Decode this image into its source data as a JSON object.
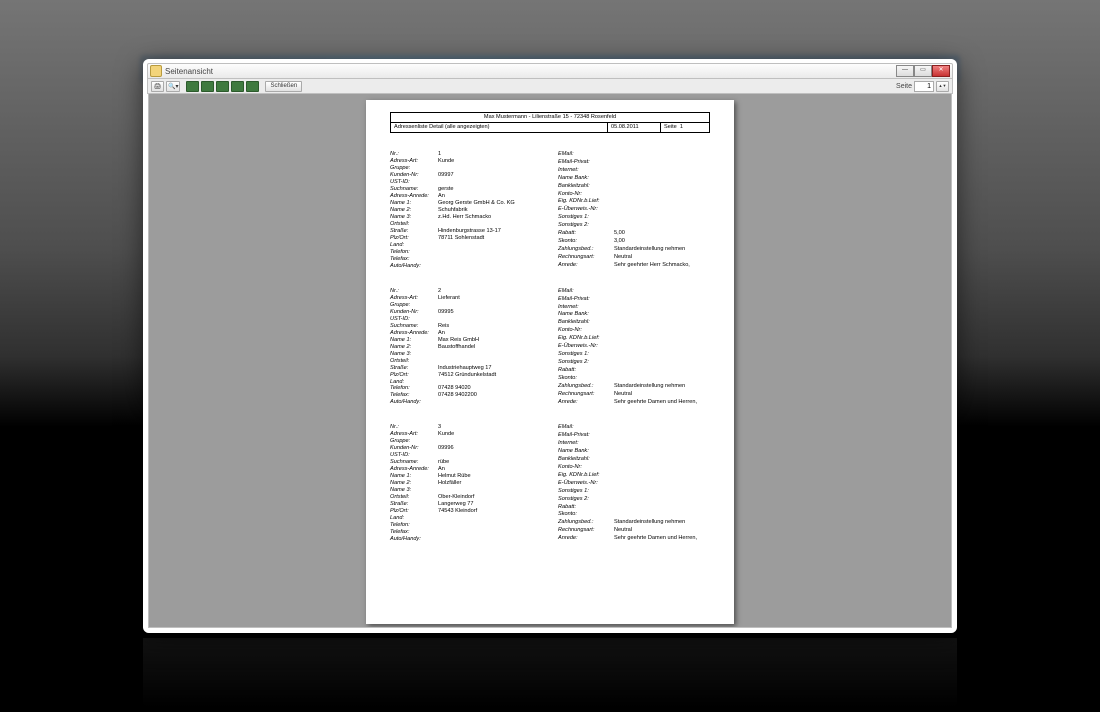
{
  "window": {
    "title": "Seitenansicht"
  },
  "toolbar": {
    "close_label": "Schließen",
    "page_label": "Seite",
    "page_value": "1"
  },
  "doc": {
    "header": {
      "owner": "Max Mustermann  -  Lilienstraße 15  -  72348 Rosenfeld",
      "title": "Adressenliste Detail  (alle angezeigten)",
      "date": "05.08.2011",
      "page_label": "Seite",
      "page_no": "1"
    },
    "left_labels": [
      "Nr.:",
      "Adress-Art:",
      "Gruppe:",
      "Kunden-Nr:",
      "UST-ID:",
      "Suchname:",
      "Adress-Anrede:",
      "Name 1:",
      "Name 2:",
      "Name 3:",
      "Ortsteil:",
      "Straße:",
      "Plz/Ort:",
      "Land:",
      "Telefon:",
      "Telefax:",
      "Auto/Handy:"
    ],
    "right_labels_1": [
      "EMail:",
      "EMail-Privat:",
      "Internet:",
      "Name Bank:",
      "Bankleitzahl:",
      "Konto-Nr:",
      "Eig. KDNr.b.Lief:",
      "E-Überweis.-Nr:",
      "Sonstiges 1:",
      "Sonstiges 2:",
      "Rabatt:",
      "Skonto:",
      "Zahlungsbed.:",
      "Rechnungsart:",
      "Anrede:"
    ],
    "right_labels_23": [
      "EMail:",
      "EMail-Privat:",
      "Internet:",
      "Name Bank:",
      "Bankleitzahl:",
      "Konto-Nr:",
      "Eig. KDNr.b.Lief:",
      "E-Überweis.-Nr:",
      "Sonstiges 1:",
      "Sonstiges 2:",
      "Rabatt:",
      "Skonto:",
      "Zahlungsbed.:",
      "Rechnungsart:",
      "Anrede:"
    ],
    "records": [
      {
        "left": [
          "1",
          "Kunde",
          "",
          "09997",
          "",
          "gerste",
          "An",
          "Georg Gerste GmbH & Co. KG",
          "Schuhfabrik",
          "z.Hd. Herr Schmacko",
          "",
          "Hindenburgstrasse 13-17",
          "78711 Sohlenstadt",
          "",
          "",
          "",
          ""
        ],
        "right": [
          "",
          "",
          "",
          "",
          "",
          "",
          "",
          "",
          "",
          "",
          "5,00",
          "3,00",
          "Standardeinstellung nehmen",
          "Neutral",
          "Sehr geehrter Herr Schmacko,"
        ]
      },
      {
        "left": [
          "2",
          "Lieferant",
          "",
          "09995",
          "",
          "Reis",
          "An",
          "Max Reis GmbH",
          "Baustoffhandel",
          "",
          "",
          "Industriehauptweg 17",
          "74512 Gründunkelstadt",
          "",
          "07428 94020",
          "07428 9402200",
          ""
        ],
        "right": [
          "",
          "",
          "",
          "",
          "",
          "",
          "",
          "",
          "",
          "",
          "",
          "",
          "Standardeinstellung nehmen",
          "Neutral",
          "Sehr geehrte Damen und Herren,"
        ]
      },
      {
        "left": [
          "3",
          "Kunde",
          "",
          "09996",
          "",
          "rübe",
          "An",
          "Helmut Rübe",
          "Holzfäller",
          "",
          "Ober-Kleindorf",
          "Langerweg 77",
          "74543 Kleindorf",
          "",
          "",
          "",
          ""
        ],
        "right": [
          "",
          "",
          "",
          "",
          "",
          "",
          "",
          "",
          "",
          "",
          "",
          "",
          "Standardeinstellung nehmen",
          "Neutral",
          "Sehr geehrte Damen und Herren,"
        ]
      }
    ]
  }
}
